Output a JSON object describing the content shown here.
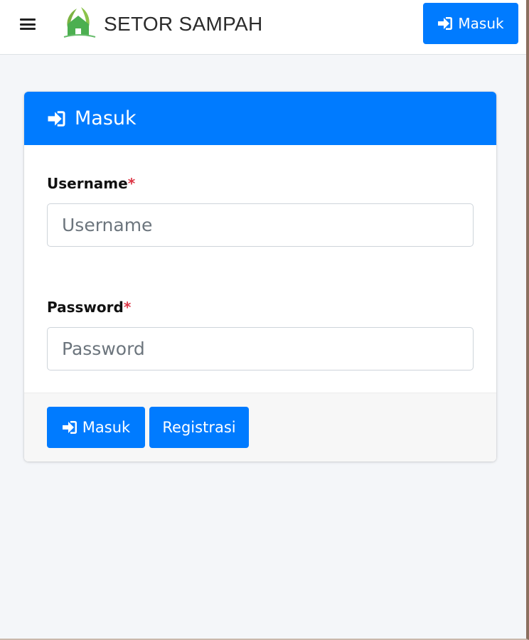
{
  "navbar": {
    "brand_name": "SETOR SAMPAH",
    "menu_icon": "hamburger-menu-icon",
    "logo_icon": "leaf-house-logo",
    "login_button_label": "Masuk",
    "login_button_icon": "sign-in-icon"
  },
  "login_card": {
    "title": "Masuk",
    "title_icon": "sign-in-icon",
    "fields": [
      {
        "label": "Username",
        "required_mark": "*",
        "value": "",
        "placeholder": "Username"
      },
      {
        "label": "Password",
        "required_mark": "*",
        "value": "",
        "placeholder": "Password"
      }
    ],
    "submit_label": "Masuk",
    "register_label": "Registrasi"
  },
  "colors": {
    "primary": "#007bff",
    "required": "#dc3545",
    "page_background": "#f4f6f9",
    "logo_green": "#4caf50"
  }
}
